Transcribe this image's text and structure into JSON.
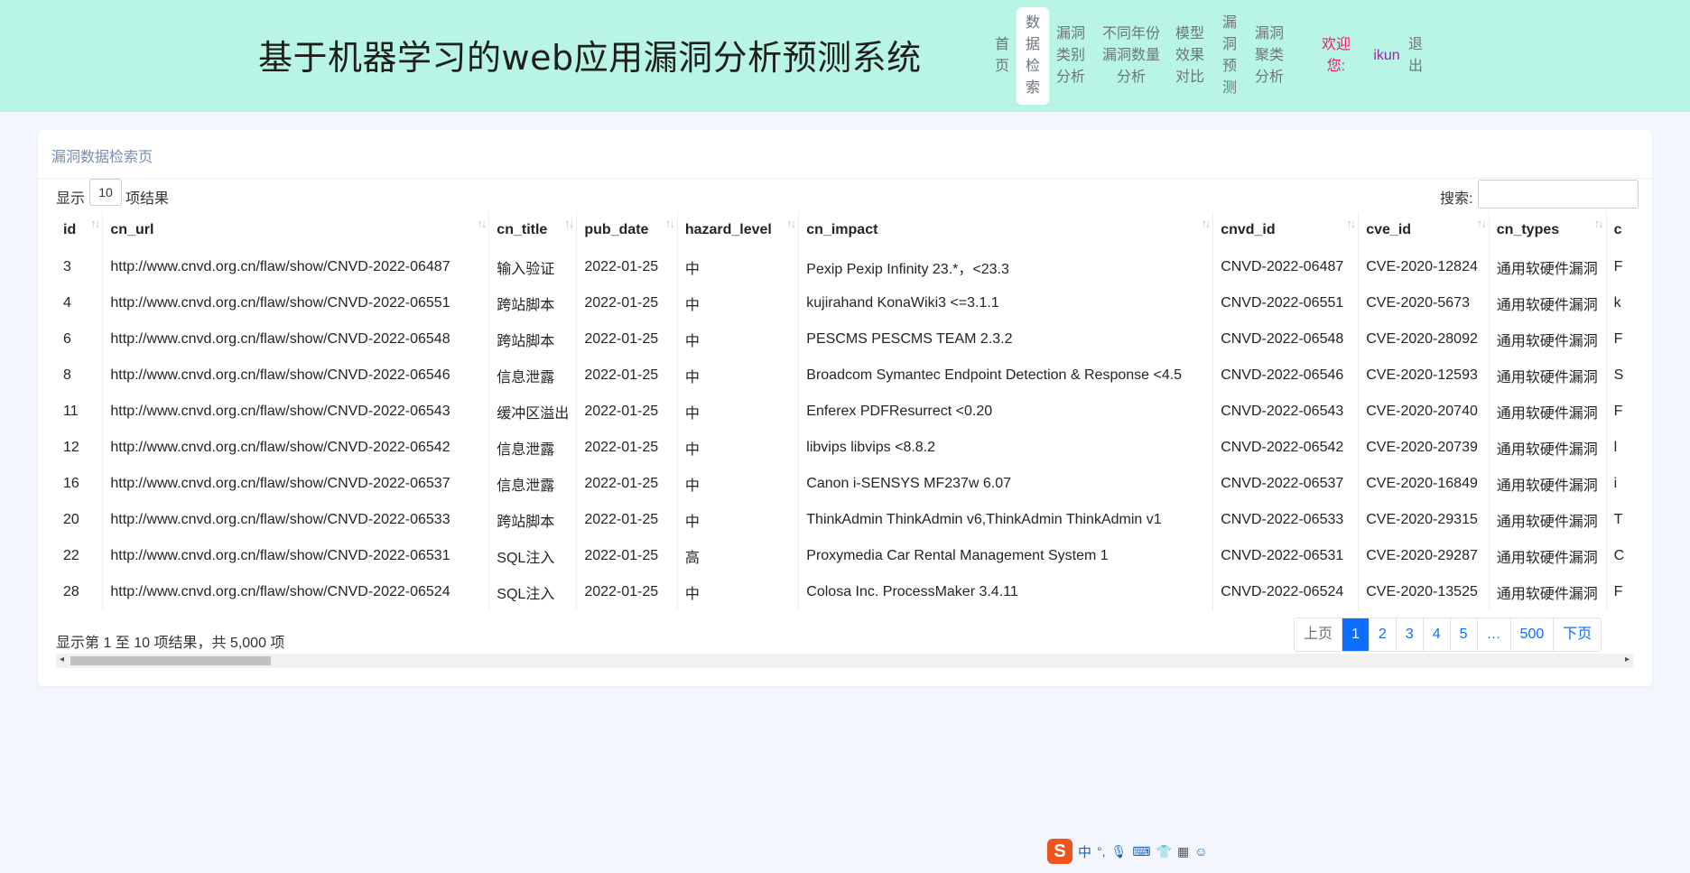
{
  "header": {
    "title": "基于机器学习的web应用漏洞分析预测系统",
    "nav": [
      {
        "label": "首\n页",
        "active": false
      },
      {
        "label": "数\n据\n检\n索",
        "active": true
      },
      {
        "label": "漏洞\n类别\n分析",
        "active": false
      },
      {
        "label": "不同年份\n漏洞数量\n分析",
        "active": false
      },
      {
        "label": "模型\n效果\n对比",
        "active": false
      },
      {
        "label": "漏\n洞\n预\n测",
        "active": false
      },
      {
        "label": "漏洞\n聚类\n分析",
        "active": false
      }
    ],
    "welcome": "欢迎\n您:",
    "username": "ikun",
    "logout": "退\n出"
  },
  "card": {
    "title": "漏洞数据检索页",
    "length_prefix": "显示",
    "length_value": "10",
    "length_suffix": "项结果",
    "search_label": "搜索:",
    "search_value": ""
  },
  "table": {
    "columns": [
      "id",
      "cn_url",
      "cn_title",
      "pub_date",
      "hazard_level",
      "cn_impact",
      "cnvd_id",
      "cve_id",
      "cn_types",
      "c"
    ],
    "rows": [
      [
        "3",
        "http://www.cnvd.org.cn/flaw/show/CNVD-2022-06487",
        "输入验证",
        "2022-01-25",
        "中",
        "Pexip Pexip Infinity 23.*，<23.3",
        "CNVD-2022-06487",
        "CVE-2020-12824",
        "通用软硬件漏洞",
        "F"
      ],
      [
        "4",
        "http://www.cnvd.org.cn/flaw/show/CNVD-2022-06551",
        "跨站脚本",
        "2022-01-25",
        "中",
        "kujirahand KonaWiki3 <=3.1.1",
        "CNVD-2022-06551",
        "CVE-2020-5673",
        "通用软硬件漏洞",
        "k"
      ],
      [
        "6",
        "http://www.cnvd.org.cn/flaw/show/CNVD-2022-06548",
        "跨站脚本",
        "2022-01-25",
        "中",
        "PESCMS PESCMS TEAM 2.3.2",
        "CNVD-2022-06548",
        "CVE-2020-28092",
        "通用软硬件漏洞",
        "F"
      ],
      [
        "8",
        "http://www.cnvd.org.cn/flaw/show/CNVD-2022-06546",
        "信息泄露",
        "2022-01-25",
        "中",
        "Broadcom Symantec Endpoint Detection & Response <4.5",
        "CNVD-2022-06546",
        "CVE-2020-12593",
        "通用软硬件漏洞",
        "S"
      ],
      [
        "11",
        "http://www.cnvd.org.cn/flaw/show/CNVD-2022-06543",
        "缓冲区溢出",
        "2022-01-25",
        "中",
        "Enferex PDFResurrect <0.20",
        "CNVD-2022-06543",
        "CVE-2020-20740",
        "通用软硬件漏洞",
        "F"
      ],
      [
        "12",
        "http://www.cnvd.org.cn/flaw/show/CNVD-2022-06542",
        "信息泄露",
        "2022-01-25",
        "中",
        "libvips libvips <8.8.2",
        "CNVD-2022-06542",
        "CVE-2020-20739",
        "通用软硬件漏洞",
        "l"
      ],
      [
        "16",
        "http://www.cnvd.org.cn/flaw/show/CNVD-2022-06537",
        "信息泄露",
        "2022-01-25",
        "中",
        "Canon i-SENSYS MF237w 6.07",
        "CNVD-2022-06537",
        "CVE-2020-16849",
        "通用软硬件漏洞",
        "i"
      ],
      [
        "20",
        "http://www.cnvd.org.cn/flaw/show/CNVD-2022-06533",
        "跨站脚本",
        "2022-01-25",
        "中",
        "ThinkAdmin ThinkAdmin v6,ThinkAdmin ThinkAdmin v1",
        "CNVD-2022-06533",
        "CVE-2020-29315",
        "通用软硬件漏洞",
        "T"
      ],
      [
        "22",
        "http://www.cnvd.org.cn/flaw/show/CNVD-2022-06531",
        "SQL注入",
        "2022-01-25",
        "高",
        "Proxymedia Car Rental Management System 1",
        "CNVD-2022-06531",
        "CVE-2020-29287",
        "通用软硬件漏洞",
        "C"
      ],
      [
        "28",
        "http://www.cnvd.org.cn/flaw/show/CNVD-2022-06524",
        "SQL注入",
        "2022-01-25",
        "中",
        "Colosa Inc. ProcessMaker 3.4.11",
        "CNVD-2022-06524",
        "CVE-2020-13525",
        "通用软硬件漏洞",
        "F"
      ]
    ]
  },
  "footer": {
    "info": "显示第 1 至 10 项结果，共 5,000 项",
    "pagination": {
      "prev": "上页",
      "pages": [
        "1",
        "2",
        "3",
        "4",
        "5",
        "…",
        "500"
      ],
      "active_page": "1",
      "next": "下页"
    }
  },
  "ime": {
    "logo": "S",
    "mode": "中"
  }
}
